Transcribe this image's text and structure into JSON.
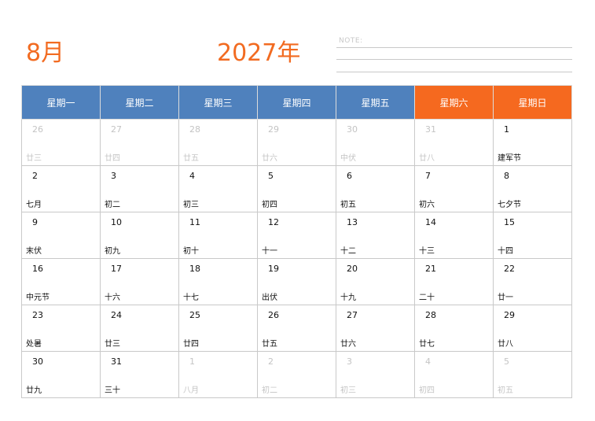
{
  "header": {
    "month": "8月",
    "year": "2027年",
    "note_label": "NOTE:"
  },
  "colors": {
    "accent": "#f26b21",
    "weekday_header": "#4f81bd",
    "weekend_header": "#f5691f"
  },
  "weekdays": [
    {
      "label": "星期一",
      "weekend": false
    },
    {
      "label": "星期二",
      "weekend": false
    },
    {
      "label": "星期三",
      "weekend": false
    },
    {
      "label": "星期四",
      "weekend": false
    },
    {
      "label": "星期五",
      "weekend": false
    },
    {
      "label": "星期六",
      "weekend": true
    },
    {
      "label": "星期日",
      "weekend": true
    }
  ],
  "weeks": [
    [
      {
        "day": "26",
        "lunar": "廿三",
        "current": false
      },
      {
        "day": "27",
        "lunar": "廿四",
        "current": false
      },
      {
        "day": "28",
        "lunar": "廿五",
        "current": false
      },
      {
        "day": "29",
        "lunar": "廿六",
        "current": false
      },
      {
        "day": "30",
        "lunar": "中伏",
        "current": false
      },
      {
        "day": "31",
        "lunar": "廿八",
        "current": false
      },
      {
        "day": "1",
        "lunar": "建军节",
        "current": true
      }
    ],
    [
      {
        "day": "2",
        "lunar": "七月",
        "current": true
      },
      {
        "day": "3",
        "lunar": "初二",
        "current": true
      },
      {
        "day": "4",
        "lunar": "初三",
        "current": true
      },
      {
        "day": "5",
        "lunar": "初四",
        "current": true
      },
      {
        "day": "6",
        "lunar": "初五",
        "current": true
      },
      {
        "day": "7",
        "lunar": "初六",
        "current": true
      },
      {
        "day": "8",
        "lunar": "七夕节",
        "current": true
      }
    ],
    [
      {
        "day": "9",
        "lunar": "末伏",
        "current": true
      },
      {
        "day": "10",
        "lunar": "初九",
        "current": true
      },
      {
        "day": "11",
        "lunar": "初十",
        "current": true
      },
      {
        "day": "12",
        "lunar": "十一",
        "current": true
      },
      {
        "day": "13",
        "lunar": "十二",
        "current": true
      },
      {
        "day": "14",
        "lunar": "十三",
        "current": true
      },
      {
        "day": "15",
        "lunar": "十四",
        "current": true
      }
    ],
    [
      {
        "day": "16",
        "lunar": "中元节",
        "current": true
      },
      {
        "day": "17",
        "lunar": "十六",
        "current": true
      },
      {
        "day": "18",
        "lunar": "十七",
        "current": true
      },
      {
        "day": "19",
        "lunar": "出伏",
        "current": true
      },
      {
        "day": "20",
        "lunar": "十九",
        "current": true
      },
      {
        "day": "21",
        "lunar": "二十",
        "current": true
      },
      {
        "day": "22",
        "lunar": "廿一",
        "current": true
      }
    ],
    [
      {
        "day": "23",
        "lunar": "处暑",
        "current": true
      },
      {
        "day": "24",
        "lunar": "廿三",
        "current": true
      },
      {
        "day": "25",
        "lunar": "廿四",
        "current": true
      },
      {
        "day": "26",
        "lunar": "廿五",
        "current": true
      },
      {
        "day": "27",
        "lunar": "廿六",
        "current": true
      },
      {
        "day": "28",
        "lunar": "廿七",
        "current": true
      },
      {
        "day": "29",
        "lunar": "廿八",
        "current": true
      }
    ],
    [
      {
        "day": "30",
        "lunar": "廿九",
        "current": true
      },
      {
        "day": "31",
        "lunar": "三十",
        "current": true
      },
      {
        "day": "1",
        "lunar": "八月",
        "current": false
      },
      {
        "day": "2",
        "lunar": "初二",
        "current": false
      },
      {
        "day": "3",
        "lunar": "初三",
        "current": false
      },
      {
        "day": "4",
        "lunar": "初四",
        "current": false
      },
      {
        "day": "5",
        "lunar": "初五",
        "current": false
      }
    ]
  ]
}
